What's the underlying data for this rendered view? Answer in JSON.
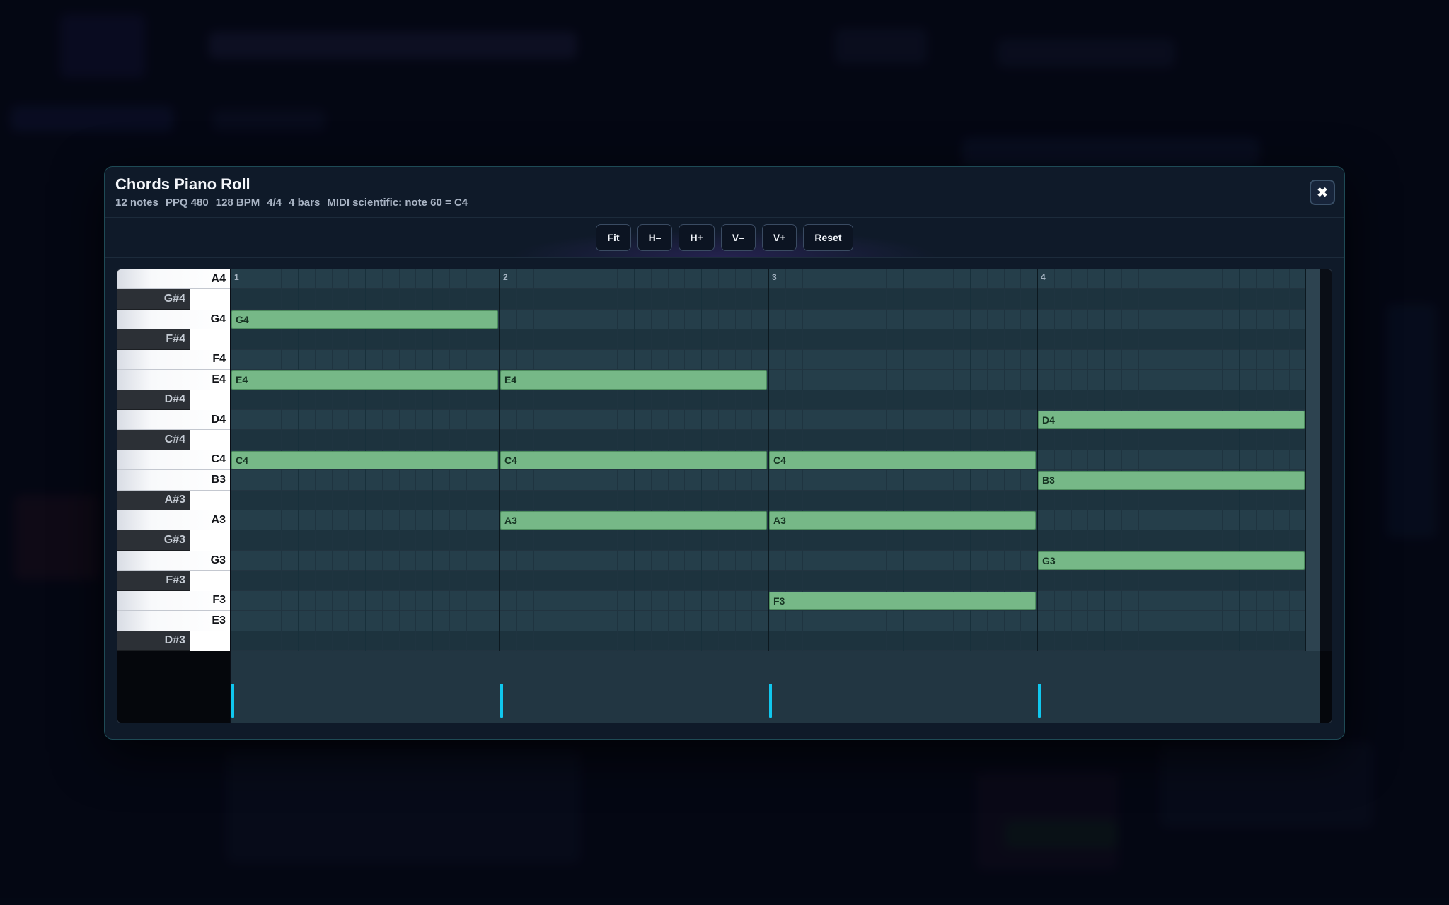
{
  "modal": {
    "title": "Chords Piano Roll",
    "meta": [
      "12 notes",
      "PPQ 480",
      "128 BPM",
      "4/4",
      "4 bars",
      "MIDI scientific: note 60 = C4"
    ],
    "close_label": "✖"
  },
  "toolbar": {
    "buttons": [
      {
        "id": "fit",
        "label": "Fit"
      },
      {
        "id": "h-minus",
        "label": "H–"
      },
      {
        "id": "h-plus",
        "label": "H+"
      },
      {
        "id": "v-minus",
        "label": "V–"
      },
      {
        "id": "v-plus",
        "label": "V+"
      },
      {
        "id": "reset",
        "label": "Reset"
      }
    ]
  },
  "piano_roll": {
    "bars": 4,
    "beats_per_bar": 4,
    "bar_labels": [
      "1",
      "2",
      "3",
      "4"
    ],
    "pitches": [
      {
        "name": "A4",
        "black": false
      },
      {
        "name": "G#4",
        "black": true
      },
      {
        "name": "G4",
        "black": false
      },
      {
        "name": "F#4",
        "black": true
      },
      {
        "name": "F4",
        "black": false
      },
      {
        "name": "E4",
        "black": false
      },
      {
        "name": "D#4",
        "black": true
      },
      {
        "name": "D4",
        "black": false
      },
      {
        "name": "C#4",
        "black": true
      },
      {
        "name": "C4",
        "black": false
      },
      {
        "name": "B3",
        "black": false
      },
      {
        "name": "A#3",
        "black": true
      },
      {
        "name": "A3",
        "black": false
      },
      {
        "name": "G#3",
        "black": true
      },
      {
        "name": "G3",
        "black": false
      },
      {
        "name": "F#3",
        "black": true
      },
      {
        "name": "F3",
        "black": false
      },
      {
        "name": "E3",
        "black": false
      },
      {
        "name": "D#3",
        "black": true
      }
    ],
    "notes": [
      {
        "pitch": "G4",
        "bar": 1
      },
      {
        "pitch": "E4",
        "bar": 1
      },
      {
        "pitch": "C4",
        "bar": 1
      },
      {
        "pitch": "E4",
        "bar": 2
      },
      {
        "pitch": "C4",
        "bar": 2
      },
      {
        "pitch": "A3",
        "bar": 2
      },
      {
        "pitch": "C4",
        "bar": 3
      },
      {
        "pitch": "A3",
        "bar": 3
      },
      {
        "pitch": "F3",
        "bar": 3
      },
      {
        "pitch": "D4",
        "bar": 4
      },
      {
        "pitch": "B3",
        "bar": 4
      },
      {
        "pitch": "G3",
        "bar": 4
      }
    ],
    "velocity_markers_at_bars": [
      1,
      2,
      3,
      4
    ]
  },
  "colors": {
    "note_fill": "#76b887",
    "velocity_marker": "#10c7ee",
    "accent_border": "#1e4a55"
  }
}
